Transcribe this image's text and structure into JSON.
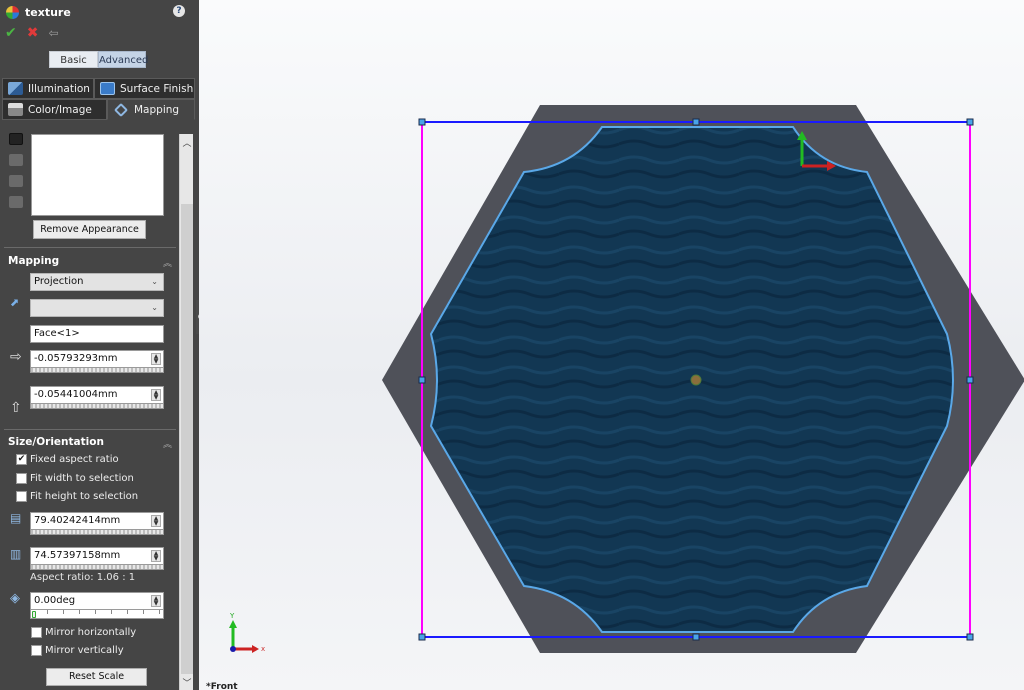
{
  "panel": {
    "title": "texture",
    "help_icon": "?",
    "actions": {
      "ok": "✔",
      "cancel": "✖",
      "pin": "⇦"
    },
    "modes": {
      "basic": "Basic",
      "advanced": "Advanced",
      "selected": "Advanced"
    },
    "tabs": [
      {
        "label": "Illumination",
        "icon": "illumination-icon",
        "active": false
      },
      {
        "label": "Surface Finish",
        "icon": "surface-finish-icon",
        "active": false
      },
      {
        "label": "Color/Image",
        "icon": "color-image-icon",
        "active": false
      },
      {
        "label": "Mapping",
        "icon": "mapping-icon",
        "active": true
      }
    ],
    "remove_appearance": "Remove Appearance",
    "mapping": {
      "title": "Mapping",
      "mapping_type": "Projection",
      "direction_dropdown": "",
      "face": "Face<1>",
      "horizontal_offset": "-0.05793293mm",
      "vertical_offset": "-0.05441004mm"
    },
    "size_orientation": {
      "title": "Size/Orientation",
      "fixed_aspect_ratio": {
        "label": "Fixed aspect ratio",
        "checked": true
      },
      "fit_width": {
        "label": "Fit width to selection",
        "checked": false
      },
      "fit_height": {
        "label": "Fit height to selection",
        "checked": false
      },
      "width": "79.40242414mm",
      "height": "74.57397158mm",
      "aspect_ratio": "Aspect ratio: 1.06 : 1",
      "rotation": "0.00deg",
      "rotation_slider": 0,
      "mirror_horizontally": {
        "label": "Mirror horizontally",
        "checked": false
      },
      "mirror_vertically": {
        "label": "Mirror vertically",
        "checked": false
      },
      "reset_scale": "Reset Scale"
    }
  },
  "viewport": {
    "triad": {
      "x_label": "x",
      "y_label": "Y"
    },
    "bottom_text": "*Front",
    "colors": {
      "body": "#4f5159",
      "water": "#0f3350",
      "edge_highlight": "#5aa8e8",
      "box_horizontal": "#1a1aff",
      "box_vertical": "#ff00ff",
      "handle": "#4aa3e8"
    }
  }
}
